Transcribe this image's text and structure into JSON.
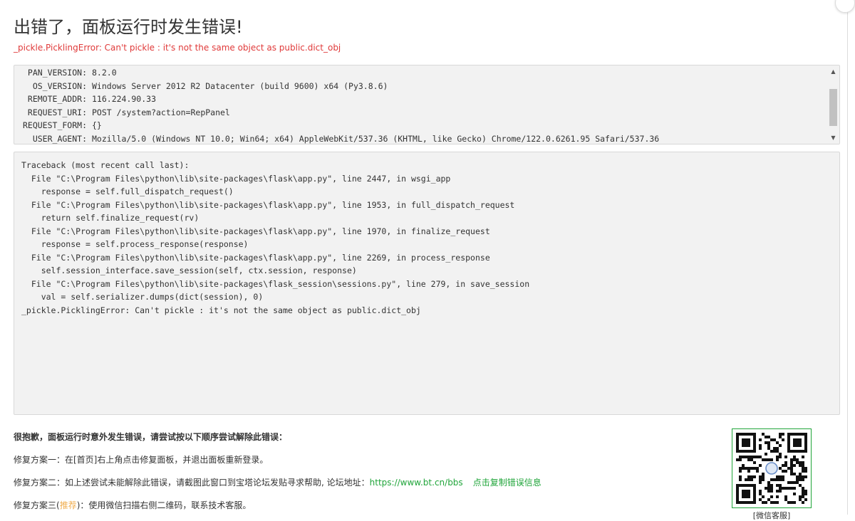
{
  "dialog": {
    "title": "出错了，面板运行时发生错误!",
    "error_summary": "_pickle.PicklingError: Can't pickle : it's not the same object as public.dict_obj"
  },
  "env": [
    {
      "key": "PAN_VERSION:",
      "value": "8.2.0"
    },
    {
      "key": "OS_VERSION:",
      "value": "Windows Server 2012 R2 Datacenter (build 9600) x64 (Py3.8.6)"
    },
    {
      "key": "REMOTE_ADDR:",
      "value": "116.224.90.33"
    },
    {
      "key": "REQUEST_URI:",
      "value": "POST /system?action=RepPanel"
    },
    {
      "key": "REQUEST_FORM:",
      "value": "{}"
    },
    {
      "key": "USER_AGENT:",
      "value": "Mozilla/5.0 (Windows NT 10.0; Win64; x64) AppleWebKit/537.36 (KHTML, like Gecko) Chrome/122.0.6261.95 Safari/537.36"
    }
  ],
  "traceback": [
    "Traceback (most recent call last):",
    "  File \"C:\\Program Files\\python\\lib\\site-packages\\flask\\app.py\", line 2447, in wsgi_app",
    "    response = self.full_dispatch_request()",
    "  File \"C:\\Program Files\\python\\lib\\site-packages\\flask\\app.py\", line 1953, in full_dispatch_request",
    "    return self.finalize_request(rv)",
    "  File \"C:\\Program Files\\python\\lib\\site-packages\\flask\\app.py\", line 1970, in finalize_request",
    "    response = self.process_response(response)",
    "  File \"C:\\Program Files\\python\\lib\\site-packages\\flask\\app.py\", line 2269, in process_response",
    "    self.session_interface.save_session(self, ctx.session, response)",
    "  File \"C:\\Program Files\\python\\lib\\site-packages\\flask_session\\sessions.py\", line 279, in save_session",
    "    val = self.serializer.dumps(dict(session), 0)",
    "_pickle.PicklingError: Can't pickle : it's not the same object as public.dict_obj"
  ],
  "help": {
    "heading": "很抱歉，面板运行时意外发生错误，请尝试按以下顺序尝试解除此错误：",
    "fix1": "修复方案一：在[首页]右上角点击修复面板，并退出面板重新登录。",
    "fix2_prefix": "修复方案二：如上述尝试未能解除此错误，请截图此窗口到宝塔论坛发贴寻求帮助, 论坛地址：",
    "forum_url": "https://www.bt.cn/bbs",
    "copy_label": "点击复制错误信息",
    "fix3_prefix": "修复方案三(",
    "fix3_recommend": "推荐",
    "fix3_suffix": ")：使用微信扫描右侧二维码，联系技术客服。"
  },
  "qr": {
    "icon": "qr-code-icon",
    "caption": "[微信客服]"
  },
  "colors": {
    "error_red": "#e03a3a",
    "link_green": "#20a53a",
    "recommend_orange": "#f0ad4e",
    "panel_bg": "#f2f2f2"
  }
}
